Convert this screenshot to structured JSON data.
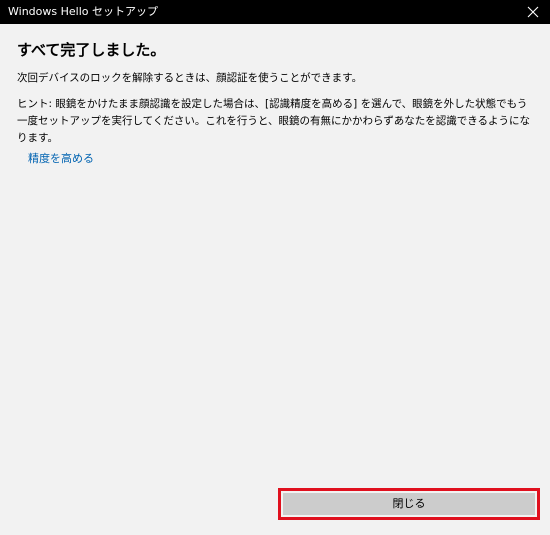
{
  "window": {
    "title": "Windows Hello セットアップ"
  },
  "icons": {
    "close": "close-icon"
  },
  "content": {
    "heading": "すべて完了しました。",
    "description": "次回デバイスのロックを解除するときは、顔認証を使うことができます。",
    "hint": "ヒント: 眼鏡をかけたまま顔認識を設定した場合は、[認識精度を高める] を選んで、眼鏡を外した状態でもう一度セットアップを実行してください。これを行うと、眼鏡の有無にかかわらずあなたを認識できるようになります。",
    "link_label": "精度を高める"
  },
  "footer": {
    "close_label": "閉じる"
  },
  "colors": {
    "titlebar": "#000000",
    "background": "#f2f2f2",
    "link": "#0063b1",
    "button": "#cccccc",
    "highlight": "#e0101e"
  }
}
